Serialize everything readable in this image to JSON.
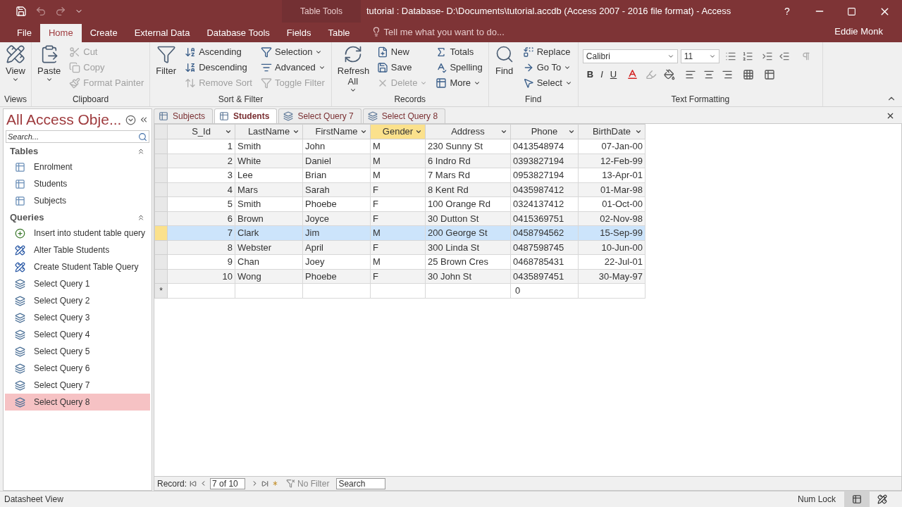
{
  "title_bar": {
    "contextual_tab": "Table Tools",
    "title": "tutorial : Database- D:\\Documents\\tutorial.accdb (Access 2007 - 2016 file format) - Access",
    "help": "?",
    "user": "Eddie Monk"
  },
  "ribbon_tabs": [
    {
      "label": "File",
      "selected": false
    },
    {
      "label": "Home",
      "selected": true
    },
    {
      "label": "Create",
      "selected": false
    },
    {
      "label": "External Data",
      "selected": false
    },
    {
      "label": "Database Tools",
      "selected": false
    },
    {
      "label": "Fields",
      "selected": false
    },
    {
      "label": "Table",
      "selected": false
    }
  ],
  "tell_me": {
    "placeholder": "Tell me what you want to do..."
  },
  "ribbon_groups": [
    {
      "label": "Views",
      "large": [
        {
          "label": "View",
          "kind": "view",
          "dropdown": true,
          "disabled": false
        }
      ]
    },
    {
      "label": "Clipboard",
      "large": [
        {
          "label": "Paste",
          "kind": "paste",
          "dropdown": true,
          "disabled": false
        }
      ],
      "columns": [
        [
          {
            "label": "Cut",
            "kind": "cut",
            "dropdown": false,
            "disabled": true
          },
          {
            "label": "Copy",
            "kind": "copy",
            "dropdown": false,
            "disabled": true
          },
          {
            "label": "Format Painter",
            "kind": "painter",
            "dropdown": false,
            "disabled": true
          }
        ]
      ]
    },
    {
      "label": "Sort & Filter",
      "large": [
        {
          "label": "Filter",
          "kind": "filter",
          "dropdown": false,
          "disabled": false
        }
      ],
      "columns": [
        [
          {
            "label": "Ascending",
            "kind": "asc",
            "dropdown": false,
            "disabled": false
          },
          {
            "label": "Descending",
            "kind": "desc",
            "dropdown": false,
            "disabled": false
          },
          {
            "label": "Remove Sort",
            "kind": "removesort",
            "dropdown": false,
            "disabled": true
          }
        ],
        [
          {
            "label": "Selection",
            "kind": "selection",
            "dropdown": true,
            "disabled": false
          },
          {
            "label": "Advanced",
            "kind": "advanced",
            "dropdown": true,
            "disabled": false
          },
          {
            "label": "Toggle Filter",
            "kind": "toggle",
            "dropdown": false,
            "disabled": true
          }
        ]
      ]
    },
    {
      "label": "Records",
      "large": [
        {
          "label": "Refresh All",
          "kind": "refresh",
          "dropdown": true,
          "disabled": false
        }
      ],
      "columns": [
        [
          {
            "label": "New",
            "kind": "new",
            "dropdown": false,
            "disabled": false
          },
          {
            "label": "Save",
            "kind": "save",
            "dropdown": false,
            "disabled": false
          },
          {
            "label": "Delete",
            "kind": "delete",
            "dropdown": true,
            "disabled": true
          }
        ],
        [
          {
            "label": "Totals",
            "kind": "totals",
            "dropdown": false,
            "disabled": false
          },
          {
            "label": "Spelling",
            "kind": "spelling",
            "dropdown": false,
            "disabled": false
          },
          {
            "label": "More",
            "kind": "more",
            "dropdown": true,
            "disabled": false
          }
        ]
      ]
    },
    {
      "label": "Find",
      "large": [
        {
          "label": "Find",
          "kind": "find",
          "dropdown": false,
          "disabled": false
        }
      ],
      "columns": [
        [
          {
            "label": "Replace",
            "kind": "replace",
            "dropdown": false,
            "disabled": false
          },
          {
            "label": "Go To",
            "kind": "goto",
            "dropdown": true,
            "disabled": false
          },
          {
            "label": "Select",
            "kind": "select",
            "dropdown": true,
            "disabled": false
          }
        ]
      ]
    }
  ],
  "text_formatting": {
    "label": "Text Formatting",
    "font": "Calibri",
    "size": "11",
    "bold": "B",
    "italic": "I",
    "underline": "U"
  },
  "nav_pane": {
    "title": "All Access Obje...",
    "search": {
      "placeholder": "Search..."
    },
    "sections": [
      {
        "title": "Tables",
        "items": [
          {
            "label": "Enrolment",
            "kind": "table",
            "selected": false
          },
          {
            "label": "Students",
            "kind": "table",
            "selected": false
          },
          {
            "label": "Subjects",
            "kind": "table",
            "selected": false
          }
        ]
      },
      {
        "title": "Queries",
        "items": [
          {
            "label": "Insert into student table query",
            "kind": "append",
            "selected": false
          },
          {
            "label": "Alter Table Students",
            "kind": "ddl",
            "selected": false
          },
          {
            "label": "Create Student Table Query",
            "kind": "ddl",
            "selected": false
          },
          {
            "label": "Select Query 1",
            "kind": "select",
            "selected": false
          },
          {
            "label": "Select Query 2",
            "kind": "select",
            "selected": false
          },
          {
            "label": "Select Query 3",
            "kind": "select",
            "selected": false
          },
          {
            "label": "Select Query 4",
            "kind": "select",
            "selected": false
          },
          {
            "label": "Select Query 5",
            "kind": "select",
            "selected": false
          },
          {
            "label": "Select Query 6",
            "kind": "select",
            "selected": false
          },
          {
            "label": "Select Query 7",
            "kind": "select",
            "selected": false
          },
          {
            "label": "Select Query 8",
            "kind": "select",
            "selected": true
          }
        ]
      }
    ]
  },
  "doc_tabs": [
    {
      "label": "Subjects",
      "kind": "table",
      "selected": false
    },
    {
      "label": "Students",
      "kind": "table",
      "selected": true
    },
    {
      "label": "Select Query 7",
      "kind": "query",
      "selected": false
    },
    {
      "label": "Select Query 8",
      "kind": "query",
      "selected": false
    }
  ],
  "table": {
    "columns": [
      {
        "label": "S_Id",
        "selected": false,
        "kind": "number"
      },
      {
        "label": "LastName",
        "selected": false,
        "kind": "text"
      },
      {
        "label": "FirstName",
        "selected": false,
        "kind": "text"
      },
      {
        "label": "Gender",
        "selected": true,
        "kind": "text"
      },
      {
        "label": "Address",
        "selected": false,
        "kind": "text"
      },
      {
        "label": "Phone",
        "selected": false,
        "kind": "text"
      },
      {
        "label": "BirthDate",
        "selected": false,
        "kind": "date"
      }
    ],
    "rows": [
      {
        "cells": [
          "1",
          "Smith",
          "John",
          "M",
          "230 Sunny St",
          "0413548974",
          "07-Jan-00"
        ],
        "selected": false
      },
      {
        "cells": [
          "2",
          "White",
          "Daniel",
          "M",
          "6 Indro Rd",
          "0393827194",
          "12-Feb-99"
        ],
        "selected": false
      },
      {
        "cells": [
          "3",
          "Lee",
          "Brian",
          "M",
          "7 Mars Rd",
          "0953827194",
          "13-Apr-01"
        ],
        "selected": false
      },
      {
        "cells": [
          "4",
          "Mars",
          "Sarah",
          "F",
          "8 Kent Rd",
          "0435987412",
          "01-Mar-98"
        ],
        "selected": false
      },
      {
        "cells": [
          "5",
          "Smith",
          "Phoebe",
          "F",
          "100 Orange Rd",
          "0324137412",
          "01-Oct-00"
        ],
        "selected": false
      },
      {
        "cells": [
          "6",
          "Brown",
          "Joyce",
          "F",
          "30 Dutton St",
          "0415369751",
          "02-Nov-98"
        ],
        "selected": false
      },
      {
        "cells": [
          "7",
          "Clark",
          "Jim",
          "M",
          "200 George St",
          "0458794562",
          "15-Sep-99"
        ],
        "selected": true
      },
      {
        "cells": [
          "8",
          "Webster",
          "April",
          "F",
          "300 Linda St",
          "0487598745",
          "10-Jun-00"
        ],
        "selected": false
      },
      {
        "cells": [
          "9",
          "Chan",
          "Joey",
          "M",
          "25 Brown Cres",
          "0468785431",
          "22-Jul-01"
        ],
        "selected": false
      },
      {
        "cells": [
          "10",
          "Wong",
          "Phoebe",
          "F",
          "30 John St",
          "0435897451",
          "30-May-97"
        ],
        "selected": false
      }
    ],
    "new_row": {
      "marker": "*",
      "cells": [
        "",
        "",
        "",
        "",
        "",
        "0",
        ""
      ]
    }
  },
  "record_nav": {
    "label": "Record:",
    "position": "7 of 10",
    "filter": "No Filter",
    "search": "Search"
  },
  "status_bar": {
    "view": "Datasheet View",
    "num_lock": "Num Lock",
    "views": [
      {
        "kind": "datasheet",
        "selected": true
      },
      {
        "kind": "design",
        "selected": false
      }
    ]
  }
}
